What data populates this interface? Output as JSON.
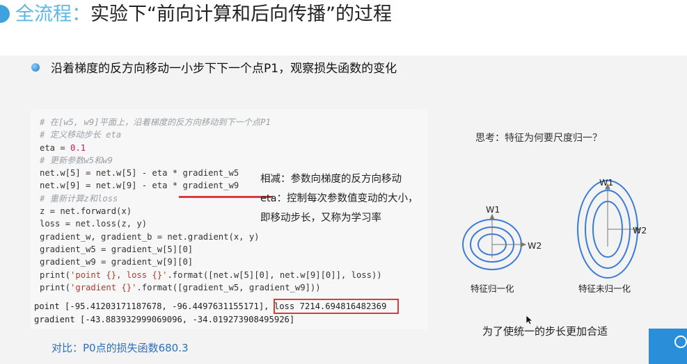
{
  "title": {
    "highlight": "全流程：",
    "main": "实验下“前向计算和后向传播”的过程"
  },
  "bullet_text": "沿着梯度的反方向移动一小步下下一个点P1，观察损失函数的变化",
  "code": {
    "lines": [
      {
        "kind": "comment",
        "text": "# 在[w5, w9]平面上，沿着梯度的反方向移动到下一个点P1"
      },
      {
        "kind": "comment",
        "text": "# 定义移动步长 eta"
      },
      {
        "kind": "eta",
        "prefix": "eta = ",
        "value": "0.1"
      },
      {
        "kind": "comment",
        "text": "# 更新参数w5和w9"
      },
      {
        "kind": "code",
        "text": "net.w[5] = net.w[5] - eta * gradient_w5"
      },
      {
        "kind": "code",
        "text": "net.w[9] = net.w[9] - eta * gradient_w9"
      },
      {
        "kind": "comment",
        "text": "# 重新计算z和loss"
      },
      {
        "kind": "code",
        "text": "z = net.forward(x)"
      },
      {
        "kind": "code",
        "text": "loss = net.loss(z, y)"
      },
      {
        "kind": "code",
        "text": "gradient_w, gradient_b = net.gradient(x, y)"
      },
      {
        "kind": "code",
        "text": "gradient_w5 = gradient_w[5][0]"
      },
      {
        "kind": "code",
        "text": "gradient_w9 = gradient_w[9][0]"
      },
      {
        "kind": "print",
        "pre": "print(",
        "str": "'point {}, loss {}'",
        "post": ".format([net.w[5][0], net.w[9][0]], loss))"
      },
      {
        "kind": "print",
        "pre": "print(",
        "str": "'gradient {}'",
        "post": ".format([gradient_w5, gradient_w9]))"
      }
    ],
    "output": {
      "point_line": "point [-95.41203171187678, -96.4497631155171], ",
      "loss_text": "loss 7214.694816482369",
      "gradient_line": "gradient [-43.883932999069096, -34.019273908495926]"
    }
  },
  "annotation": {
    "line1": "相减：参数向梯度的反方向移动",
    "line2": "eta：控制每次参数值变动的大小，",
    "line3": "即移动步长，又称为学习率"
  },
  "compare_text": "对比：P0点的损失函数680.3",
  "think_text": "思考：特征为何要尺度归一？",
  "diagram": {
    "left": {
      "axis_v": "W1",
      "axis_h": "W2",
      "caption": "特征归一化"
    },
    "right": {
      "axis_v": "W1",
      "axis_h": "W2",
      "caption": "特征未归一化"
    }
  },
  "conclusion_text": "为了使统一的步长更加合适",
  "colors": {
    "title_highlight": "#5bb7e8",
    "accent_red": "#d93b3b",
    "compare_blue": "#2a6fbf"
  }
}
